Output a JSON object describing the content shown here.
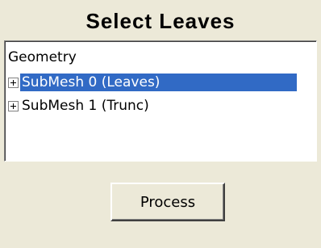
{
  "panel": {
    "title": "Select Leaves"
  },
  "tree": {
    "root_label": "Geometry",
    "items": [
      {
        "label": "SubMesh 0 (Leaves)",
        "selected": true,
        "expander": "plus-expander-icon"
      },
      {
        "label": "SubMesh 1 (Trunc)",
        "selected": false,
        "expander": "plus-expander-icon"
      }
    ],
    "selection_color": "#316ac5"
  },
  "actions": {
    "process_label": "Process"
  }
}
